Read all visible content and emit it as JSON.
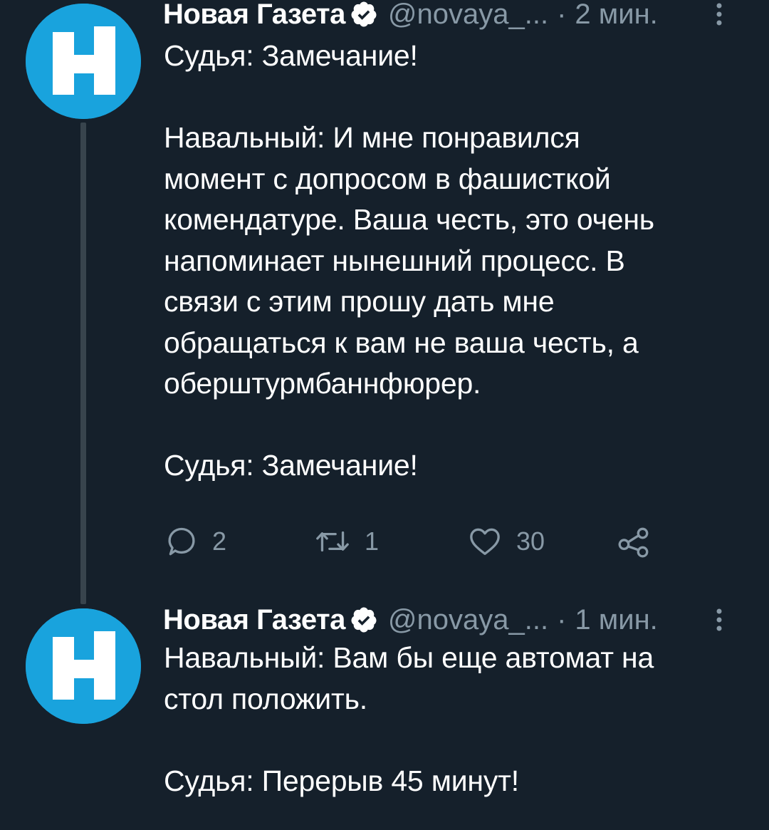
{
  "colors": {
    "background": "#15202b",
    "text_primary": "#ffffff",
    "text_secondary": "#8899a6",
    "avatar_brand": "#19a3dd",
    "thread_line": "#38444d"
  },
  "tweets": [
    {
      "author": {
        "display_name": "Новая Газета",
        "handle": "@novaya_...",
        "verified": true,
        "avatar_icon": "novaya-gazeta-logo"
      },
      "separator": "·",
      "timestamp": "2 мин.",
      "text": "Судья: Замечание!\n\nНавальный: И мне понравился\nмомент с допросом в фашисткой\nкомендатуре. Ваша честь, это очень\nнапоминает нынешний процесс. В\nсвязи с этим прошу дать мне\nобращаться к вам не ваша честь, а\nоберштурмбаннфюрер.\n\nСудья: Замечание!",
      "actions": {
        "reply_count": "2",
        "retweet_count": "1",
        "like_count": "30",
        "share_icon": "share-icon"
      }
    },
    {
      "author": {
        "display_name": "Новая Газета",
        "handle": "@novaya_...",
        "verified": true,
        "avatar_icon": "novaya-gazeta-logo"
      },
      "separator": "·",
      "timestamp": "1 мин.",
      "text": "Навальный: Вам бы еще автомат на\nстол положить.\n\nСудья: Перерыв 45 минут!"
    }
  ]
}
